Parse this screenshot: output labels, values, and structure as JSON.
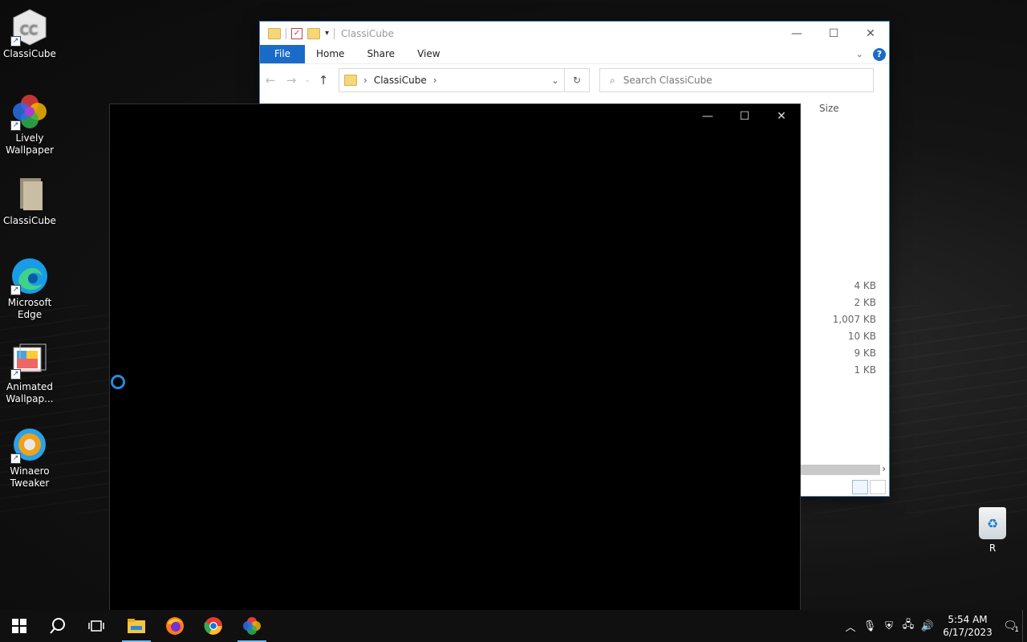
{
  "desktop": {
    "icons": [
      {
        "label": "ClassiCube",
        "icon": "classicube-app-icon"
      },
      {
        "label": "Lively Wallpaper",
        "icon": "lively-wallpaper-icon"
      },
      {
        "label": "ClassiCube",
        "icon": "folder-icon"
      },
      {
        "label": "Microsoft Edge",
        "icon": "edge-icon"
      },
      {
        "label": "Animated Wallpap...",
        "icon": "animated-wallpaper-icon"
      },
      {
        "label": "Winaero Tweaker",
        "icon": "winaero-tweaker-icon"
      }
    ],
    "recycle_bin_label": "R"
  },
  "explorer": {
    "title": "ClassiCube",
    "ribbon": {
      "file": "File",
      "home": "Home",
      "share": "Share",
      "view": "View"
    },
    "address": {
      "crumb": "ClassiCube"
    },
    "search": {
      "placeholder": "Search ClassiCube"
    },
    "column_size": "Size",
    "sizes": [
      "4 KB",
      "2 KB",
      "1,007 KB",
      "10 KB",
      "9 KB",
      "1 KB"
    ]
  },
  "app_window": {
    "background": "#000000"
  },
  "taskbar": {
    "clock_time": "5:54 AM",
    "clock_date": "6/17/2023",
    "notification_count": "1",
    "pinned": [
      "file-explorer-icon",
      "firefox-icon",
      "chrome-icon",
      "lively-wallpaper-icon"
    ]
  },
  "colors": {
    "accent": "#1a6bc7",
    "taskbar": "#101010"
  }
}
